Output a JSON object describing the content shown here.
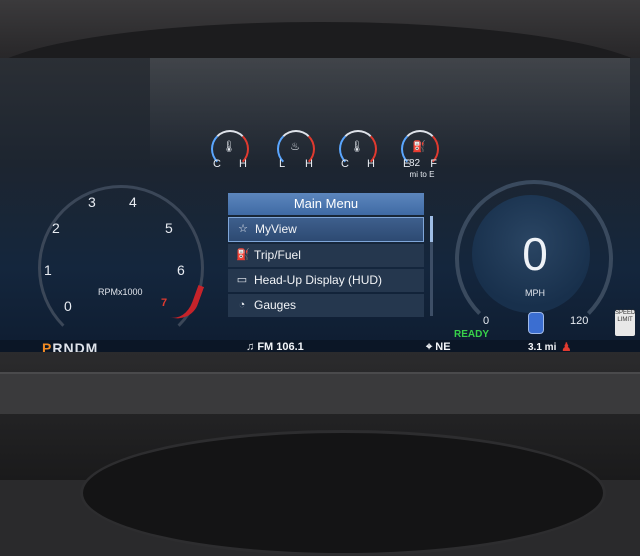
{
  "gauges": {
    "coolant": {
      "lo": "C",
      "hi": "H"
    },
    "oil": {
      "lo": "L",
      "hi": "H"
    },
    "trans": {
      "lo": "C",
      "hi": "H"
    },
    "fuel": {
      "lo": "E",
      "mid": "82",
      "hi": "F",
      "sub": "mi to E"
    }
  },
  "tach": {
    "ticks": [
      "0",
      "1",
      "2",
      "3",
      "4",
      "5",
      "6",
      "7"
    ],
    "label": "RPMx1000"
  },
  "menu": {
    "title": "Main Menu",
    "items": [
      {
        "label": "MyView",
        "icon": "☆"
      },
      {
        "label": "Trip/Fuel",
        "icon": "⛽"
      },
      {
        "label": "Head-Up Display (HUD)",
        "icon": "▭"
      },
      {
        "label": "Gauges",
        "icon": "◔"
      }
    ]
  },
  "speedometer": {
    "value": "0",
    "unit": "MPH",
    "min": "0",
    "max": "120"
  },
  "status": {
    "ready": "READY",
    "gear_active": "P",
    "gear_rest": "RNDM",
    "radio": "FM 106.1",
    "compass": "NE",
    "odometer": "3.1 mi"
  },
  "colors": {
    "accent_blue": "#5c86bd",
    "warning_red": "#e03a2f",
    "ready_green": "#38d24a",
    "gear_orange": "#f08a24"
  }
}
